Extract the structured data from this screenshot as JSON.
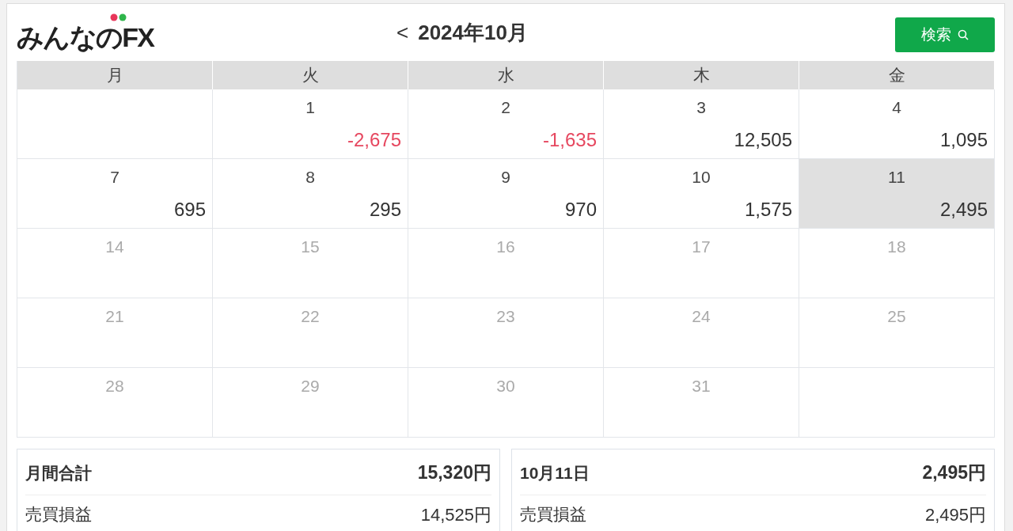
{
  "logo": "みんなのFX",
  "header": {
    "prev": "<",
    "month": "2024年10月",
    "search_button": "検索"
  },
  "weekdays": [
    "月",
    "火",
    "水",
    "木",
    "金"
  ],
  "weeks": [
    [
      {
        "kind": "empty"
      },
      {
        "kind": "day",
        "day": "1",
        "amount": "-2,675",
        "loss": true,
        "past": true,
        "selected": false
      },
      {
        "kind": "day",
        "day": "2",
        "amount": "-1,635",
        "loss": true,
        "past": true,
        "selected": false
      },
      {
        "kind": "day",
        "day": "3",
        "amount": "12,505",
        "loss": false,
        "past": true,
        "selected": false
      },
      {
        "kind": "day",
        "day": "4",
        "amount": "1,095",
        "loss": false,
        "past": true,
        "selected": false
      }
    ],
    [
      {
        "kind": "day",
        "day": "7",
        "amount": "695",
        "loss": false,
        "past": true,
        "selected": false
      },
      {
        "kind": "day",
        "day": "8",
        "amount": "295",
        "loss": false,
        "past": true,
        "selected": false
      },
      {
        "kind": "day",
        "day": "9",
        "amount": "970",
        "loss": false,
        "past": true,
        "selected": false
      },
      {
        "kind": "day",
        "day": "10",
        "amount": "1,575",
        "loss": false,
        "past": true,
        "selected": false
      },
      {
        "kind": "day",
        "day": "11",
        "amount": "2,495",
        "loss": false,
        "past": true,
        "selected": true
      }
    ],
    [
      {
        "kind": "day",
        "day": "14",
        "past": false,
        "selected": false
      },
      {
        "kind": "day",
        "day": "15",
        "past": false,
        "selected": false
      },
      {
        "kind": "day",
        "day": "16",
        "past": false,
        "selected": false
      },
      {
        "kind": "day",
        "day": "17",
        "past": false,
        "selected": false
      },
      {
        "kind": "day",
        "day": "18",
        "past": false,
        "selected": false
      }
    ],
    [
      {
        "kind": "day",
        "day": "21",
        "past": false,
        "selected": false
      },
      {
        "kind": "day",
        "day": "22",
        "past": false,
        "selected": false
      },
      {
        "kind": "day",
        "day": "23",
        "past": false,
        "selected": false
      },
      {
        "kind": "day",
        "day": "24",
        "past": false,
        "selected": false
      },
      {
        "kind": "day",
        "day": "25",
        "past": false,
        "selected": false
      }
    ],
    [
      {
        "kind": "day",
        "day": "28",
        "past": false,
        "selected": false
      },
      {
        "kind": "day",
        "day": "29",
        "past": false,
        "selected": false
      },
      {
        "kind": "day",
        "day": "30",
        "past": false,
        "selected": false
      },
      {
        "kind": "day",
        "day": "31",
        "past": false,
        "selected": false
      },
      {
        "kind": "empty"
      }
    ]
  ],
  "summaries": [
    {
      "title": "月間合計",
      "total": "15,320円",
      "rows": [
        {
          "label": "売買損益",
          "value": "14,525円"
        }
      ]
    },
    {
      "title": "10月11日",
      "total": "2,495円",
      "rows": [
        {
          "label": "売買損益",
          "value": "2,495円"
        }
      ]
    }
  ]
}
